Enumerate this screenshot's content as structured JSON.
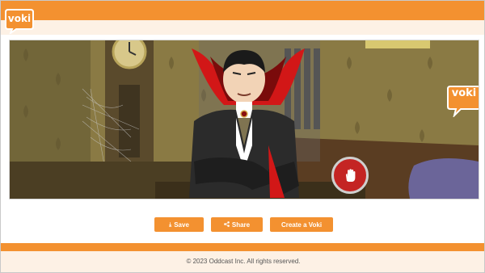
{
  "brand": {
    "logo_text": "voki",
    "accent": "#f39130",
    "pale": "#fdf1e5"
  },
  "stage": {
    "character": "vampire",
    "play_control": "hand-stop-icon"
  },
  "actions": {
    "save_label": "Save",
    "share_label": "Share",
    "create_label": "Create a Voki"
  },
  "icons": {
    "save": "download-icon",
    "share": "share-icon"
  },
  "footer": {
    "copyright": "© 2023 Oddcast Inc. All rights reserved."
  }
}
